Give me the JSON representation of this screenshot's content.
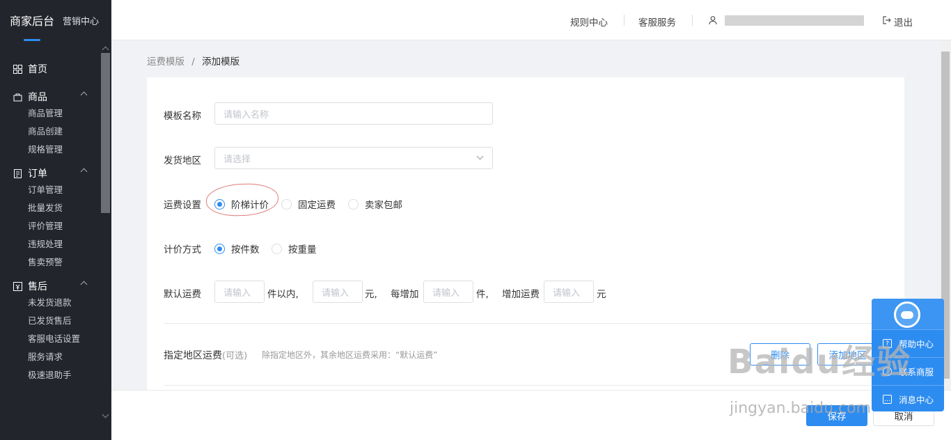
{
  "sidebar": {
    "brand": "商家后台",
    "brand_sub": "营销中心",
    "home": "首页",
    "groups": [
      {
        "label": "商品",
        "items": [
          "商品管理",
          "商品创建",
          "规格管理"
        ]
      },
      {
        "label": "订单",
        "items": [
          "订单管理",
          "批量发货",
          "评价管理",
          "违规处理",
          "售卖预警"
        ]
      },
      {
        "label": "售后",
        "items": [
          "未发货退款",
          "已发货售后",
          "客服电话设置",
          "服务请求",
          "极速退助手"
        ]
      }
    ]
  },
  "header": {
    "rules": "规则中心",
    "service": "客服服务",
    "logout": "退出"
  },
  "breadcrumb": {
    "parent": "运费模版",
    "sep": "/",
    "current": "添加模版"
  },
  "form": {
    "name_label": "模板名称",
    "name_placeholder": "请输入名称",
    "region_label": "发货地区",
    "region_placeholder": "请选择",
    "fee_label": "运费设置",
    "fee_options": [
      "阶梯计价",
      "固定运费",
      "卖家包邮"
    ],
    "fee_selected": "阶梯计价",
    "pricing_label": "计价方式",
    "pricing_options": [
      "按件数",
      "按重量"
    ],
    "pricing_selected": "按件数",
    "default_label": "默认运费",
    "input_placeholder": "请输入",
    "within_text": "件以内,",
    "yuan_text": "元,",
    "each_add_text": "每增加",
    "piece_text": "件,",
    "add_fee_text": "增加运费",
    "yuan_end": "元",
    "region_fee_label": "指定地区运费",
    "optional_text": "(可选)",
    "region_fee_hint": "除指定地区外，其余地区运费采用：“默认运费”",
    "delete_button": "删除",
    "add_region_button": "添加地区"
  },
  "footer": {
    "save": "保存",
    "cancel": "取消"
  },
  "help_panel": {
    "items": [
      "帮助中心",
      "联系商服",
      "消息中心"
    ]
  },
  "watermark": {
    "logo": "Baidu经验",
    "url": "jingyan.baidu.com"
  },
  "colors": {
    "primary": "#2d8cf0",
    "sidebar_bg": "#22252c",
    "annotation": "#e07a7a"
  }
}
